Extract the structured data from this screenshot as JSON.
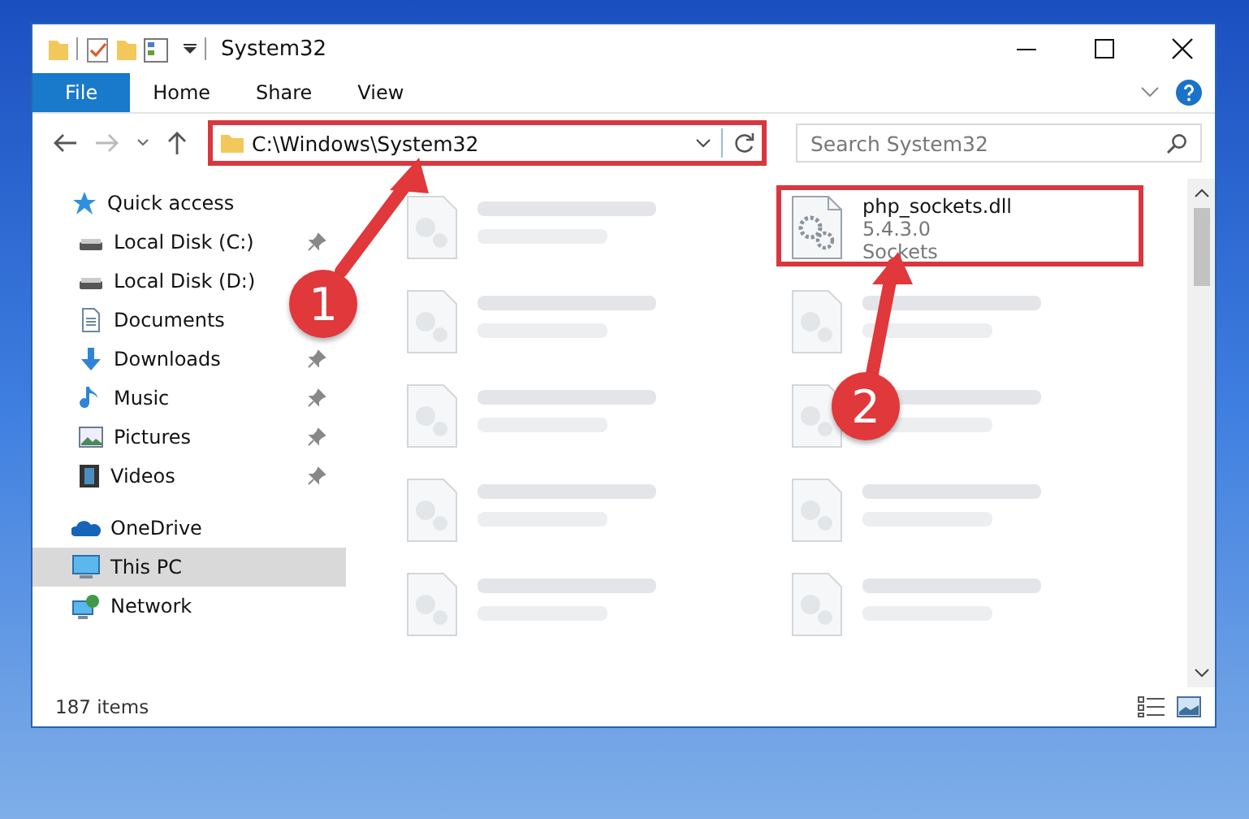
{
  "window": {
    "title": "System32"
  },
  "ribbon_tabs": [
    {
      "label": "File",
      "selected": true
    },
    {
      "label": "Home",
      "selected": false
    },
    {
      "label": "Share",
      "selected": false
    },
    {
      "label": "View",
      "selected": false
    }
  ],
  "address_bar": {
    "value": "C:\\Windows\\System32",
    "highlighted": true
  },
  "search": {
    "placeholder": "Search System32"
  },
  "sidebar": {
    "items": [
      {
        "label": "Quick access",
        "kind": "star",
        "selected": false,
        "children": [
          {
            "label": "Local Disk (C:)",
            "kind": "drive",
            "pinned": true,
            "selected": false
          },
          {
            "label": "Local Disk (D:)",
            "kind": "drive",
            "pinned": false,
            "selected": false
          },
          {
            "label": "Documents",
            "kind": "document",
            "pinned": false,
            "selected": false
          },
          {
            "label": "Downloads",
            "kind": "download",
            "pinned": true,
            "selected": false
          },
          {
            "label": "Music",
            "kind": "music",
            "pinned": true,
            "selected": false
          },
          {
            "label": "Pictures",
            "kind": "pictures",
            "pinned": true,
            "selected": false
          },
          {
            "label": "Videos",
            "kind": "videos",
            "pinned": true,
            "selected": false
          }
        ]
      },
      {
        "label": "OneDrive",
        "kind": "cloud",
        "selected": false
      },
      {
        "label": "This PC",
        "kind": "computer",
        "selected": true
      },
      {
        "label": "Network",
        "kind": "network",
        "selected": false
      }
    ]
  },
  "files": [
    {
      "blurred": true
    },
    {
      "name": "php_sockets.dll",
      "details": [
        "5.4.3.0",
        "Sockets"
      ],
      "blurred": false,
      "highlighted": true
    },
    {
      "blurred": true
    },
    {
      "blurred": true
    },
    {
      "blurred": true
    },
    {
      "blurred": true
    },
    {
      "blurred": true
    },
    {
      "blurred": true
    },
    {
      "blurred": true
    },
    {
      "blurred": true
    }
  ],
  "status_bar": {
    "item_count": "187 items"
  },
  "annotations": [
    {
      "label": "1"
    },
    {
      "label": "2"
    }
  ]
}
